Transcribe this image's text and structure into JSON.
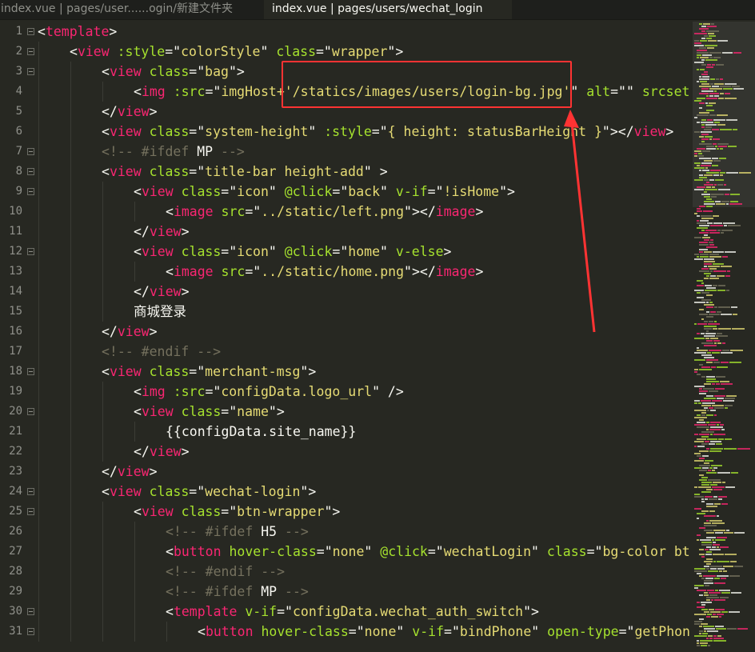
{
  "tabs": [
    {
      "label": "index.vue | pages/user......ogin/新建文件夹",
      "active": false
    },
    {
      "label": "index.vue | pages/users/wechat_login",
      "active": true
    }
  ],
  "lines": [
    {
      "n": "1",
      "fold": true,
      "indent": 0,
      "tokens": [
        [
          "w",
          "<"
        ],
        [
          "t",
          "template"
        ],
        [
          "w",
          ">"
        ]
      ]
    },
    {
      "n": "2",
      "fold": true,
      "indent": 1,
      "tokens": [
        [
          "w",
          "<"
        ],
        [
          "t",
          "view"
        ],
        [
          "w",
          " "
        ],
        [
          "a",
          ":style"
        ],
        [
          "w",
          "=\""
        ],
        [
          "s",
          "colorStyle"
        ],
        [
          "w",
          "\" "
        ],
        [
          "a",
          "class"
        ],
        [
          "w",
          "=\""
        ],
        [
          "s",
          "wrapper"
        ],
        [
          "w",
          "\">"
        ]
      ]
    },
    {
      "n": "3",
      "fold": true,
      "indent": 2,
      "tokens": [
        [
          "w",
          "<"
        ],
        [
          "t",
          "view"
        ],
        [
          "w",
          " "
        ],
        [
          "a",
          "class"
        ],
        [
          "w",
          "=\""
        ],
        [
          "s",
          "bag"
        ],
        [
          "w",
          "\">"
        ]
      ]
    },
    {
      "n": "4",
      "fold": false,
      "indent": 3,
      "tokens": [
        [
          "w",
          "<"
        ],
        [
          "t",
          "img"
        ],
        [
          "w",
          " "
        ],
        [
          "a",
          ":src"
        ],
        [
          "w",
          "=\""
        ],
        [
          "s",
          "imgHost+'/statics/images/users/login-bg.jpg'"
        ],
        [
          "w",
          "\" "
        ],
        [
          "a",
          "alt"
        ],
        [
          "w",
          "=\"\" "
        ],
        [
          "a",
          "srcset"
        ]
      ]
    },
    {
      "n": "5",
      "fold": false,
      "indent": 2,
      "tokens": [
        [
          "w",
          "</"
        ],
        [
          "t",
          "view"
        ],
        [
          "w",
          ">"
        ]
      ]
    },
    {
      "n": "6",
      "fold": false,
      "indent": 2,
      "tokens": [
        [
          "w",
          "<"
        ],
        [
          "t",
          "view"
        ],
        [
          "w",
          " "
        ],
        [
          "a",
          "class"
        ],
        [
          "w",
          "=\""
        ],
        [
          "s",
          "system-height"
        ],
        [
          "w",
          "\" "
        ],
        [
          "a",
          ":style"
        ],
        [
          "w",
          "=\""
        ],
        [
          "s",
          "{ height: statusBarHeight }"
        ],
        [
          "w",
          "\"></"
        ],
        [
          "t",
          "view"
        ],
        [
          "w",
          ">"
        ]
      ]
    },
    {
      "n": "7",
      "fold": true,
      "indent": 2,
      "tokens": [
        [
          "c",
          "<!-- #ifdef "
        ],
        [
          "w",
          "MP"
        ],
        [
          "c",
          " -->"
        ]
      ]
    },
    {
      "n": "8",
      "fold": true,
      "indent": 2,
      "tokens": [
        [
          "w",
          "<"
        ],
        [
          "t",
          "view"
        ],
        [
          "w",
          " "
        ],
        [
          "a",
          "class"
        ],
        [
          "w",
          "=\""
        ],
        [
          "s",
          "title-bar height-add"
        ],
        [
          "w",
          "\" >"
        ]
      ]
    },
    {
      "n": "9",
      "fold": true,
      "indent": 3,
      "tokens": [
        [
          "w",
          "<"
        ],
        [
          "t",
          "view"
        ],
        [
          "w",
          " "
        ],
        [
          "a",
          "class"
        ],
        [
          "w",
          "=\""
        ],
        [
          "s",
          "icon"
        ],
        [
          "w",
          "\" "
        ],
        [
          "a",
          "@click"
        ],
        [
          "w",
          "=\""
        ],
        [
          "s",
          "back"
        ],
        [
          "w",
          "\" "
        ],
        [
          "a",
          "v-if"
        ],
        [
          "w",
          "=\""
        ],
        [
          "s",
          "!isHome"
        ],
        [
          "w",
          "\">"
        ]
      ]
    },
    {
      "n": "10",
      "fold": false,
      "indent": 4,
      "tokens": [
        [
          "w",
          "<"
        ],
        [
          "t",
          "image"
        ],
        [
          "w",
          " "
        ],
        [
          "a",
          "src"
        ],
        [
          "w",
          "=\""
        ],
        [
          "s",
          "../static/left.png"
        ],
        [
          "w",
          "\"></"
        ],
        [
          "t",
          "image"
        ],
        [
          "w",
          ">"
        ]
      ]
    },
    {
      "n": "11",
      "fold": false,
      "indent": 3,
      "tokens": [
        [
          "w",
          "</"
        ],
        [
          "t",
          "view"
        ],
        [
          "w",
          ">"
        ]
      ]
    },
    {
      "n": "12",
      "fold": true,
      "indent": 3,
      "tokens": [
        [
          "w",
          "<"
        ],
        [
          "t",
          "view"
        ],
        [
          "w",
          " "
        ],
        [
          "a",
          "class"
        ],
        [
          "w",
          "=\""
        ],
        [
          "s",
          "icon"
        ],
        [
          "w",
          "\" "
        ],
        [
          "a",
          "@click"
        ],
        [
          "w",
          "=\""
        ],
        [
          "s",
          "home"
        ],
        [
          "w",
          "\" "
        ],
        [
          "a",
          "v-else"
        ],
        [
          "w",
          ">"
        ]
      ]
    },
    {
      "n": "13",
      "fold": false,
      "indent": 4,
      "tokens": [
        [
          "w",
          "<"
        ],
        [
          "t",
          "image"
        ],
        [
          "w",
          " "
        ],
        [
          "a",
          "src"
        ],
        [
          "w",
          "=\""
        ],
        [
          "s",
          "../static/home.png"
        ],
        [
          "w",
          "\"></"
        ],
        [
          "t",
          "image"
        ],
        [
          "w",
          ">"
        ]
      ]
    },
    {
      "n": "14",
      "fold": false,
      "indent": 3,
      "tokens": [
        [
          "w",
          "</"
        ],
        [
          "t",
          "view"
        ],
        [
          "w",
          ">"
        ]
      ]
    },
    {
      "n": "15",
      "fold": false,
      "indent": 3,
      "tokens": [
        [
          "cjk",
          "商城登录"
        ]
      ]
    },
    {
      "n": "16",
      "fold": false,
      "indent": 2,
      "tokens": [
        [
          "w",
          "</"
        ],
        [
          "t",
          "view"
        ],
        [
          "w",
          ">"
        ]
      ]
    },
    {
      "n": "17",
      "fold": false,
      "indent": 2,
      "tokens": [
        [
          "c",
          "<!-- #endif -->"
        ]
      ]
    },
    {
      "n": "18",
      "fold": true,
      "indent": 2,
      "tokens": [
        [
          "w",
          "<"
        ],
        [
          "t",
          "view"
        ],
        [
          "w",
          " "
        ],
        [
          "a",
          "class"
        ],
        [
          "w",
          "=\""
        ],
        [
          "s",
          "merchant-msg"
        ],
        [
          "w",
          "\">"
        ]
      ]
    },
    {
      "n": "19",
      "fold": false,
      "indent": 3,
      "tokens": [
        [
          "w",
          "<"
        ],
        [
          "t",
          "img"
        ],
        [
          "w",
          " "
        ],
        [
          "a",
          ":src"
        ],
        [
          "w",
          "=\""
        ],
        [
          "s",
          "configData.logo_url"
        ],
        [
          "w",
          "\" />"
        ]
      ]
    },
    {
      "n": "20",
      "fold": true,
      "indent": 3,
      "tokens": [
        [
          "w",
          "<"
        ],
        [
          "t",
          "view"
        ],
        [
          "w",
          " "
        ],
        [
          "a",
          "class"
        ],
        [
          "w",
          "=\""
        ],
        [
          "s",
          "name"
        ],
        [
          "w",
          "\">"
        ]
      ]
    },
    {
      "n": "21",
      "fold": false,
      "indent": 4,
      "tokens": [
        [
          "w",
          "{{configData.site_name}}"
        ]
      ]
    },
    {
      "n": "22",
      "fold": false,
      "indent": 3,
      "tokens": [
        [
          "w",
          "</"
        ],
        [
          "t",
          "view"
        ],
        [
          "w",
          ">"
        ]
      ]
    },
    {
      "n": "23",
      "fold": false,
      "indent": 2,
      "tokens": [
        [
          "w",
          "</"
        ],
        [
          "t",
          "view"
        ],
        [
          "w",
          ">"
        ]
      ]
    },
    {
      "n": "24",
      "fold": true,
      "indent": 2,
      "tokens": [
        [
          "w",
          "<"
        ],
        [
          "t",
          "view"
        ],
        [
          "w",
          " "
        ],
        [
          "a",
          "class"
        ],
        [
          "w",
          "=\""
        ],
        [
          "s",
          "wechat-login"
        ],
        [
          "w",
          "\">"
        ]
      ]
    },
    {
      "n": "25",
      "fold": true,
      "indent": 3,
      "tokens": [
        [
          "w",
          "<"
        ],
        [
          "t",
          "view"
        ],
        [
          "w",
          " "
        ],
        [
          "a",
          "class"
        ],
        [
          "w",
          "=\""
        ],
        [
          "s",
          "btn-wrapper"
        ],
        [
          "w",
          "\">"
        ]
      ]
    },
    {
      "n": "26",
      "fold": false,
      "indent": 4,
      "tokens": [
        [
          "c",
          "<!-- #ifdef "
        ],
        [
          "w",
          "H5"
        ],
        [
          "c",
          " -->"
        ]
      ]
    },
    {
      "n": "27",
      "fold": false,
      "indent": 4,
      "tokens": [
        [
          "w",
          "<"
        ],
        [
          "t",
          "button"
        ],
        [
          "w",
          " "
        ],
        [
          "a",
          "hover-class"
        ],
        [
          "w",
          "=\""
        ],
        [
          "s",
          "none"
        ],
        [
          "w",
          "\" "
        ],
        [
          "a",
          "@click"
        ],
        [
          "w",
          "=\""
        ],
        [
          "s",
          "wechatLogin"
        ],
        [
          "w",
          "\" "
        ],
        [
          "a",
          "class"
        ],
        [
          "w",
          "=\""
        ],
        [
          "s",
          "bg-color bt"
        ]
      ]
    },
    {
      "n": "28",
      "fold": false,
      "indent": 4,
      "tokens": [
        [
          "c",
          "<!-- #endif -->"
        ]
      ]
    },
    {
      "n": "29",
      "fold": false,
      "indent": 4,
      "tokens": [
        [
          "c",
          "<!-- #ifdef "
        ],
        [
          "w",
          "MP"
        ],
        [
          "c",
          " -->"
        ]
      ]
    },
    {
      "n": "30",
      "fold": true,
      "indent": 4,
      "tokens": [
        [
          "w",
          "<"
        ],
        [
          "t",
          "template"
        ],
        [
          "w",
          " "
        ],
        [
          "a",
          "v-if"
        ],
        [
          "w",
          "=\""
        ],
        [
          "s",
          "configData.wechat_auth_switch"
        ],
        [
          "w",
          "\">"
        ]
      ]
    },
    {
      "n": "31",
      "fold": true,
      "indent": 5,
      "tokens": [
        [
          "w",
          "<"
        ],
        [
          "t",
          "button"
        ],
        [
          "w",
          " "
        ],
        [
          "a",
          "hover-class"
        ],
        [
          "w",
          "=\""
        ],
        [
          "s",
          "none"
        ],
        [
          "w",
          "\" "
        ],
        [
          "a",
          "v-if"
        ],
        [
          "w",
          "=\""
        ],
        [
          "s",
          "bindPhone"
        ],
        [
          "w",
          "\" "
        ],
        [
          "a",
          "open-type"
        ],
        [
          "w",
          "=\""
        ],
        [
          "s",
          "getPhon"
        ]
      ]
    }
  ],
  "annotation": {
    "color": "#ff3333",
    "target_line": "4"
  },
  "colors": {
    "background": "#272822",
    "tag": "#f92672",
    "attribute": "#a6e22e",
    "string": "#e6db74",
    "comment": "#75715e",
    "text": "#f8f8f2",
    "gutter": "#8f908a"
  }
}
